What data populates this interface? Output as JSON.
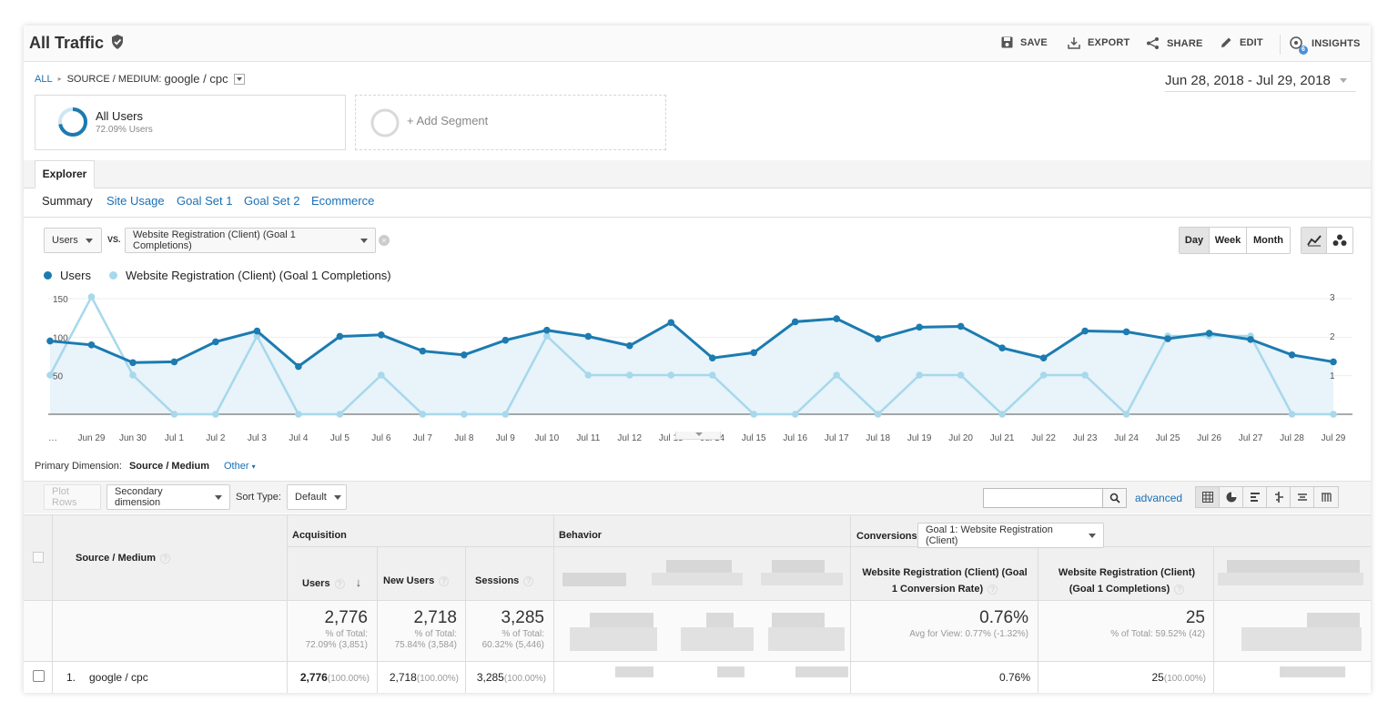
{
  "header": {
    "title": "All Traffic",
    "actions": [
      {
        "label": "SAVE",
        "icon": "save-icon"
      },
      {
        "label": "EXPORT",
        "icon": "export-icon"
      },
      {
        "label": "SHARE",
        "icon": "share-icon"
      },
      {
        "label": "EDIT",
        "icon": "edit-icon"
      },
      {
        "label": "INSIGHTS",
        "icon": "insights-icon",
        "badge": "6"
      }
    ]
  },
  "breadcrumb": {
    "root": "ALL",
    "sep": "▸",
    "dimension": "SOURCE / MEDIUM:",
    "value": "google / cpc"
  },
  "date_range": "Jun 28, 2018 - Jul 29, 2018",
  "segments": {
    "active": {
      "name": "All Users",
      "sub": "72.09% Users"
    },
    "add": "+ Add Segment"
  },
  "explorer": {
    "tab": "Explorer",
    "subtabs": [
      "Summary",
      "Site Usage",
      "Goal Set 1",
      "Goal Set 2",
      "Ecommerce"
    ]
  },
  "metrics": {
    "primary": "Users",
    "vs": "VS.",
    "secondary": "Website Registration (Client) (Goal 1 Completions)"
  },
  "period": {
    "options": [
      "Day",
      "Week",
      "Month"
    ],
    "selected": "Day"
  },
  "colors": {
    "users": "#1c7bb0",
    "goal": "#a7d8ec",
    "area": "#e8f3fa",
    "link": "#1a6fb5"
  },
  "chart_data": {
    "type": "line",
    "x": [
      "…",
      "Jun 29",
      "Jun 30",
      "Jul 1",
      "Jul 2",
      "Jul 3",
      "Jul 4",
      "Jul 5",
      "Jul 6",
      "Jul 7",
      "Jul 8",
      "Jul 9",
      "Jul 10",
      "Jul 11",
      "Jul 12",
      "Jul 13",
      "Jul 14",
      "Jul 15",
      "Jul 16",
      "Jul 17",
      "Jul 18",
      "Jul 19",
      "Jul 20",
      "Jul 21",
      "Jul 22",
      "Jul 23",
      "Jul 24",
      "Jul 25",
      "Jul 26",
      "Jul 27",
      "Jul 28",
      "Jul 29"
    ],
    "series": [
      {
        "name": "Users",
        "axis": "left",
        "values": [
          95,
          90,
          67,
          68,
          94,
          108,
          62,
          101,
          103,
          82,
          77,
          96,
          109,
          101,
          89,
          119,
          73,
          80,
          120,
          124,
          98,
          113,
          114,
          86,
          73,
          108,
          107,
          98,
          105,
          97,
          77,
          68
        ]
      },
      {
        "name": "Website Registration (Client) (Goal 1 Completions)",
        "axis": "right",
        "values": [
          1,
          3,
          1,
          0,
          0,
          2,
          0,
          0,
          1,
          0,
          0,
          0,
          2,
          1,
          1,
          1,
          1,
          0,
          0,
          1,
          0,
          1,
          1,
          0,
          1,
          1,
          0,
          2,
          2,
          2,
          0,
          0
        ]
      }
    ],
    "left_ticks": [
      "150",
      "100",
      "50"
    ],
    "right_ticks": [
      "3",
      "2",
      "1"
    ],
    "ylim_left": [
      0,
      150
    ],
    "ylim_right": [
      0,
      3
    ]
  },
  "table_controls": {
    "primary_label": "Primary Dimension:",
    "primary_value": "Source / Medium",
    "other": "Other",
    "plot_rows": "Plot Rows",
    "secondary": "Secondary dimension",
    "sort_label": "Sort Type:",
    "sort_value": "Default",
    "advanced": "advanced"
  },
  "table": {
    "dim_header": "Source / Medium",
    "groups": {
      "acquisition": "Acquisition",
      "behavior": "Behavior",
      "conversions": "Conversions"
    },
    "goal_select": "Goal 1: Website Registration (Client)",
    "columns": {
      "users": "Users",
      "new_users": "New Users",
      "sessions": "Sessions",
      "conv_rate": "Website Registration (Client) (Goal 1 Conversion Rate)",
      "completions": "Website Registration (Client) (Goal 1 Completions)"
    },
    "totals": {
      "users": {
        "value": "2,776",
        "sub1": "% of Total:",
        "sub2": "72.09% (3,851)"
      },
      "new_users": {
        "value": "2,718",
        "sub1": "% of Total:",
        "sub2": "75.84% (3,584)"
      },
      "sessions": {
        "value": "3,285",
        "sub1": "% of Total:",
        "sub2": "60.32% (5,446)"
      },
      "conv_rate": {
        "value": "0.76%",
        "sub1": "Avg for View: 0.77% (-1.32%)"
      },
      "completions": {
        "value": "25",
        "sub1": "% of Total: 59.52% (42)"
      }
    },
    "rows": [
      {
        "index": "1.",
        "name": "google / cpc",
        "users": "2,776",
        "users_pct": "(100.00%)",
        "new_users": "2,718",
        "new_users_pct": "(100.00%)",
        "sessions": "3,285",
        "sessions_pct": "(100.00%)",
        "conv_rate": "0.76%",
        "completions": "25",
        "completions_pct": "(100.00%)"
      }
    ]
  }
}
